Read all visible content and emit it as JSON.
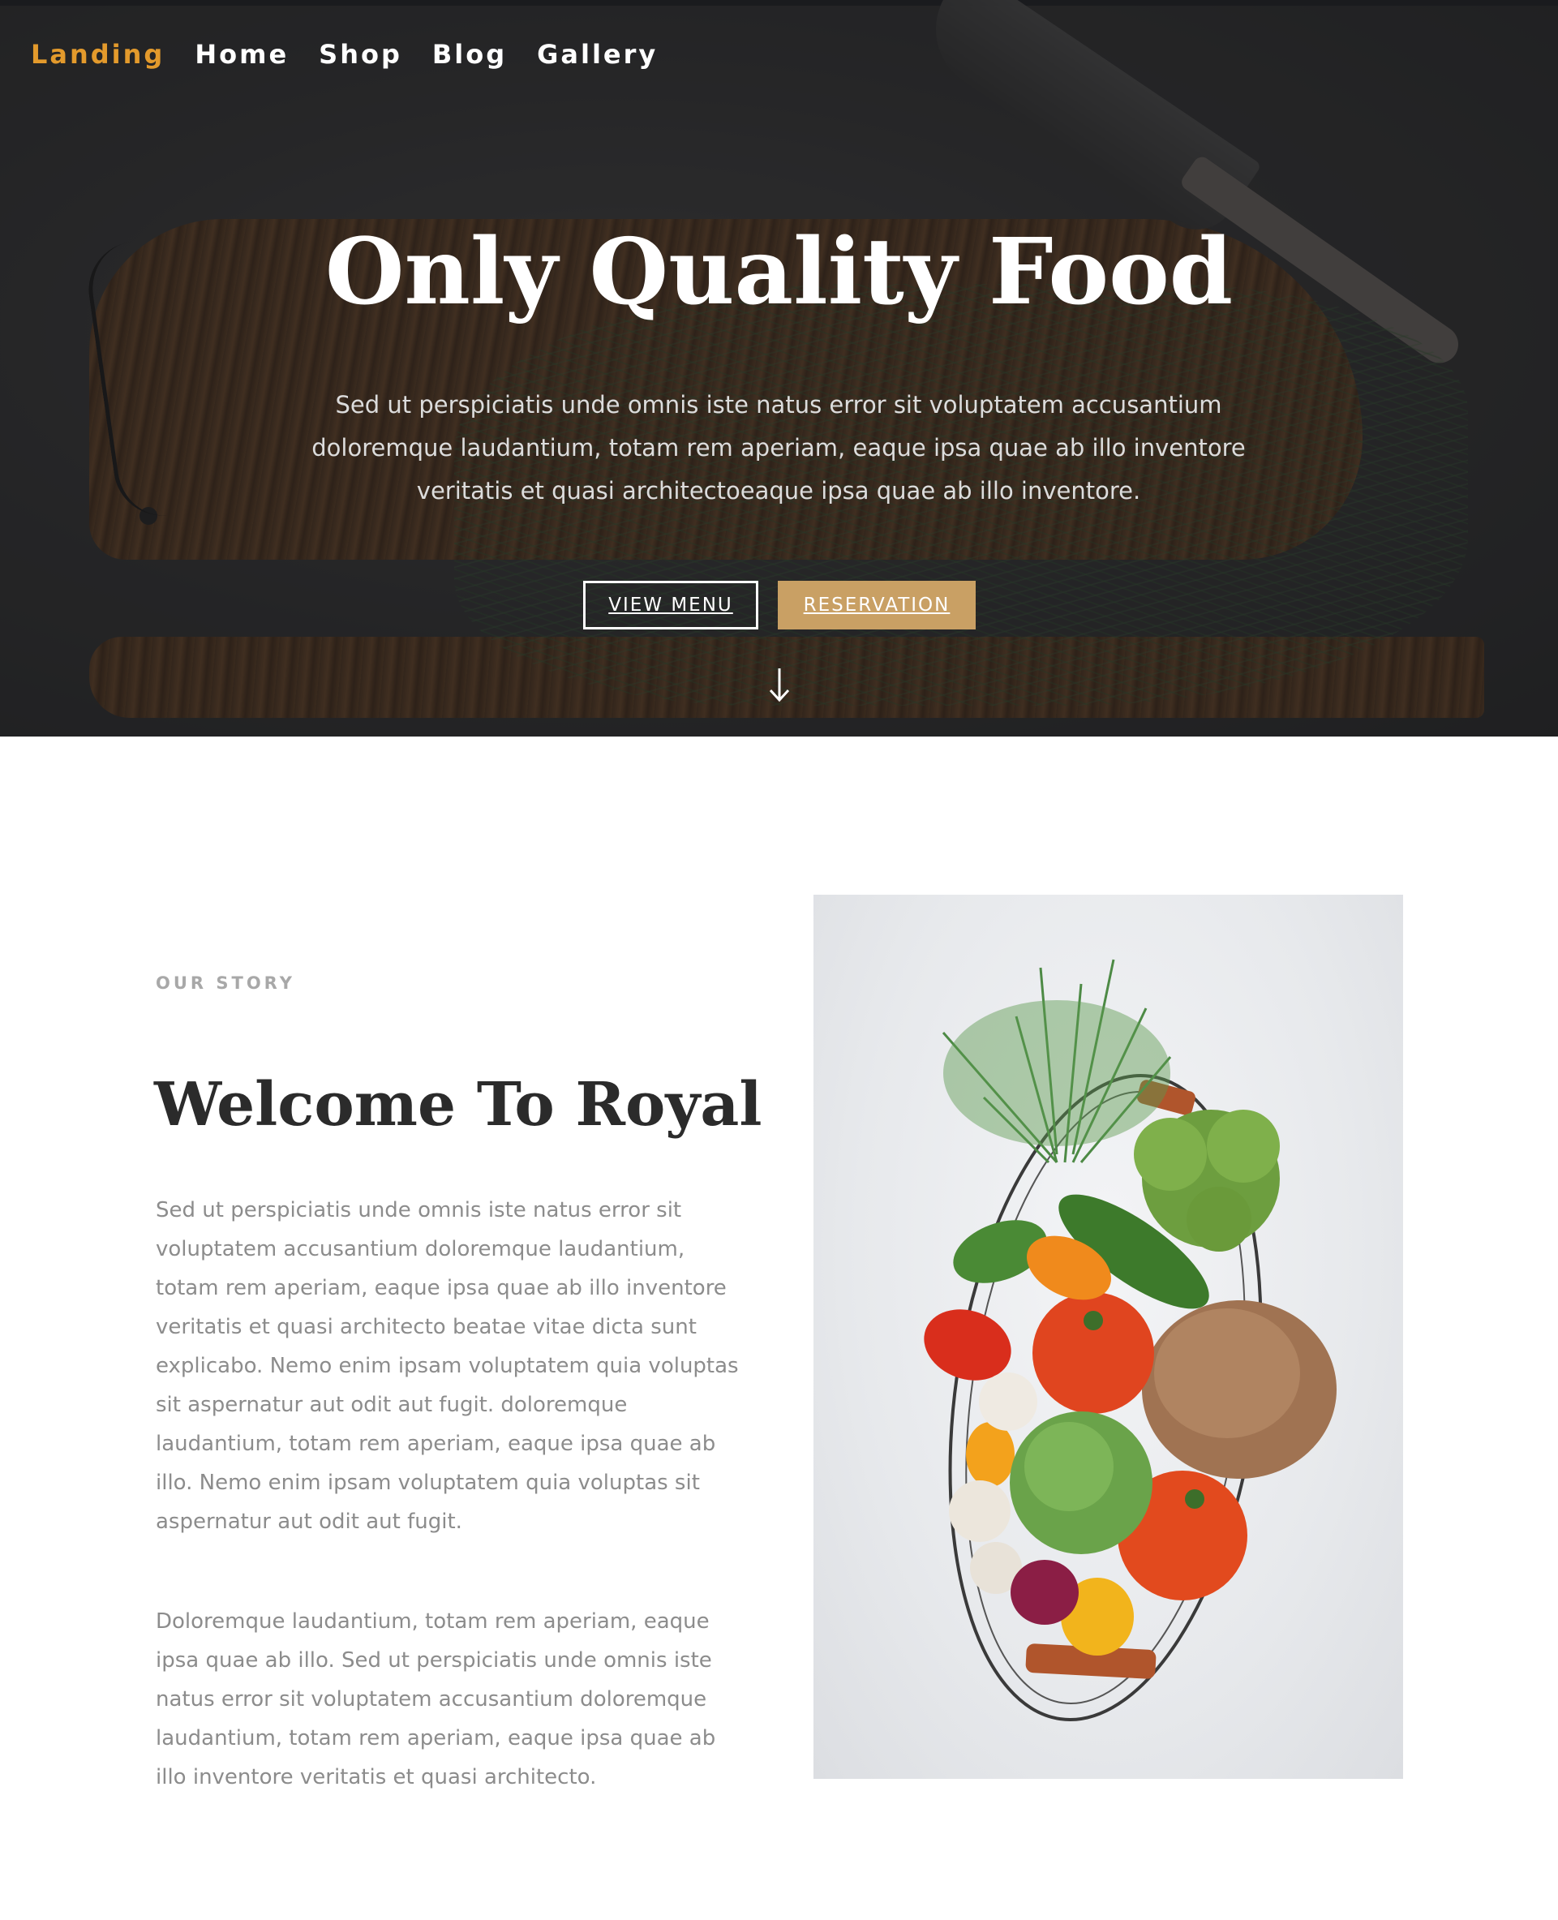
{
  "nav": {
    "items": [
      "Landing",
      "Home",
      "Shop",
      "Blog",
      "Gallery"
    ]
  },
  "hero": {
    "title": "Only Quality Food",
    "text": "Sed ut perspiciatis unde omnis iste natus error sit voluptatem accusantium doloremque laudantium, totam rem aperiam, eaque ipsa quae ab illo inventore veritatis et quasi architectoeaque ipsa quae ab illo inventore.",
    "view_menu_label": "VIEW MENU",
    "reservation_label": "RESERVATION"
  },
  "story": {
    "eyebrow": "OUR STORY",
    "title": "Welcome To Royal",
    "paragraph_1": "Sed ut perspiciatis unde omnis iste natus error sit voluptatem accusantium doloremque laudantium, totam rem aperiam, eaque ipsa quae ab illo inventore veritatis et quasi architecto beatae vitae dicta sunt explicabo. Nemo enim ipsam voluptatem quia voluptas sit aspernatur aut odit aut fugit. doloremque laudantium, totam rem aperiam, eaque ipsa quae ab illo. Nemo enim ipsam voluptatem quia voluptas sit aspernatur aut odit aut fugit.",
    "paragraph_2": "Doloremque laudantium, totam rem aperiam, eaque ipsa quae ab illo. Sed ut perspiciatis unde omnis iste natus error sit voluptatem accusantium doloremque laudantium, totam rem aperiam, eaque ipsa quae ab illo inventore veritatis et quasi architecto."
  },
  "colors": {
    "accent_active_nav": "#e39a2c",
    "reservation_button": "#c9a064",
    "heading_dark": "#2b2b2b",
    "body_gray": "#8c8c8c"
  },
  "icons": {
    "scroll": "arrow-down-icon"
  }
}
